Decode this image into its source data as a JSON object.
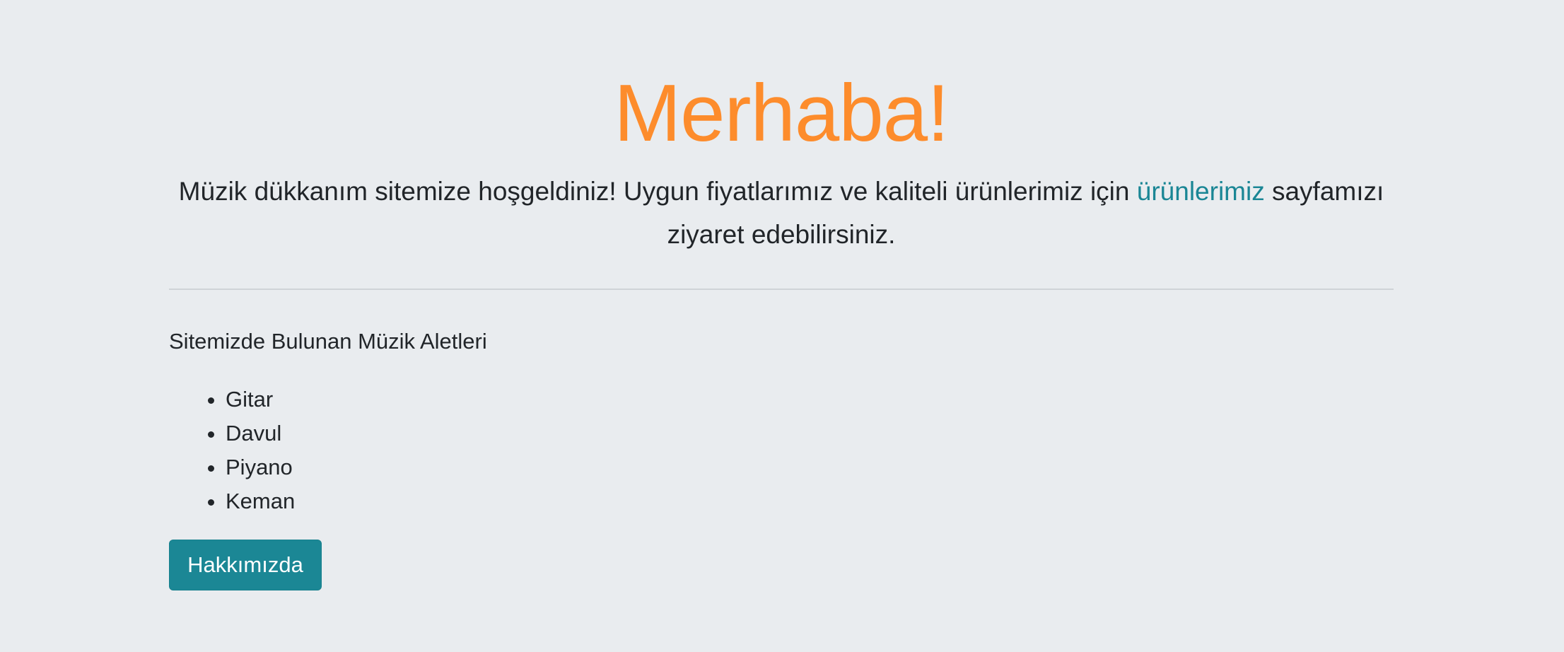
{
  "hero": {
    "title": "Merhaba!",
    "lead_before_link": "Müzik dükkanım sitemize hoşgeldiniz! Uygun fiyatlarımız ve kaliteli ürünlerimiz için ",
    "lead_link": "ürünlerimiz",
    "lead_after_link": " sayfamızı ziyaret edebilirsiniz."
  },
  "instruments": {
    "heading": "Sitemizde Bulunan Müzik Aletleri",
    "items": [
      "Gitar",
      "Davul",
      "Piyano",
      "Keman"
    ]
  },
  "actions": {
    "about_label": "Hakkımızda"
  },
  "colors": {
    "background": "#e9ecef",
    "title": "#fd8c2c",
    "link": "#1a8695",
    "button": "#1b8795",
    "text": "#212529"
  }
}
